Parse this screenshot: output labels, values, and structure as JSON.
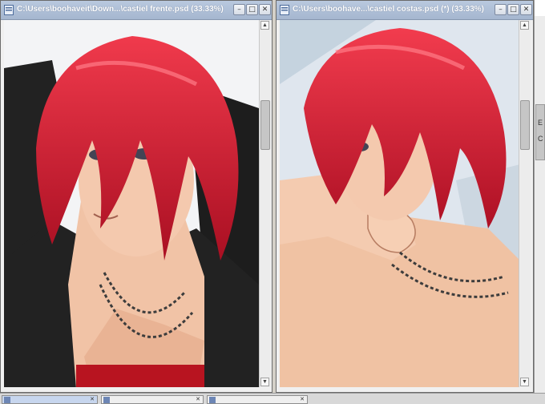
{
  "windows": [
    {
      "title": "C:\\Users\\boohaveit\\Down...\\castiel frente.psd (33.33%)",
      "buttons": {
        "minimize": "–",
        "maximize": "□",
        "close": "✕"
      }
    },
    {
      "title": "C:\\Users\\boohave...\\castiel costas.psd (*) (33.33%)",
      "buttons": {
        "minimize": "–",
        "maximize": "□",
        "close": "✕"
      }
    }
  ],
  "side_panel": {
    "letters": [
      "E",
      "C"
    ]
  },
  "scroll_arrows": {
    "up": "▲",
    "down": "▼"
  },
  "taskbar": {
    "close_glyph": "✕"
  },
  "colors": {
    "hair": "#d0182e",
    "skin": "#f1c3a6",
    "jacket": "#1f1f1f",
    "titlebar": "#a5b6cf"
  }
}
